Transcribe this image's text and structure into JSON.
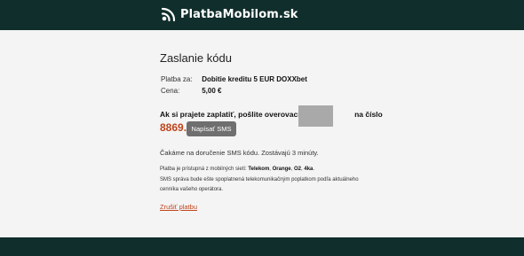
{
  "header": {
    "brand": "PlatbaMobilom.sk",
    "brand_icon": "wifi-signal-logo-icon"
  },
  "page": {
    "title": "Zaslanie kódu",
    "payment_label": "Platba za:",
    "payment_value": "Dobitie kreditu 5 EUR DOXXbet",
    "price_label": "Cena:",
    "price_value": "5,00 €",
    "instruction_before": "Ak si prajete zaplatiť, pošlite overovací kód",
    "instruction_after": "na číslo",
    "sms_number": "8869.",
    "send_sms_button": "Napísať SMS",
    "waiting_text": "Čakáme na doručenie SMS kódu. Zostávajú 3 minúty.",
    "operators_prefix": "Platba je prístupná z mobilných sietí:",
    "operators": [
      "Telekom",
      "Orange",
      "O2",
      "4ka"
    ],
    "fee_note_line1": "SMS správa bude ešte spoplatnená telekomunikačným poplatkom podľa aktuálneho",
    "fee_note_line2": "cenníka vašeho operátora.",
    "cancel_link": "Zrušiť platbu"
  },
  "colors": {
    "header_bg": "#102e2b",
    "content_bg": "#f4f4f4",
    "accent": "#c0441c",
    "button_bg": "#6f6f6f"
  }
}
